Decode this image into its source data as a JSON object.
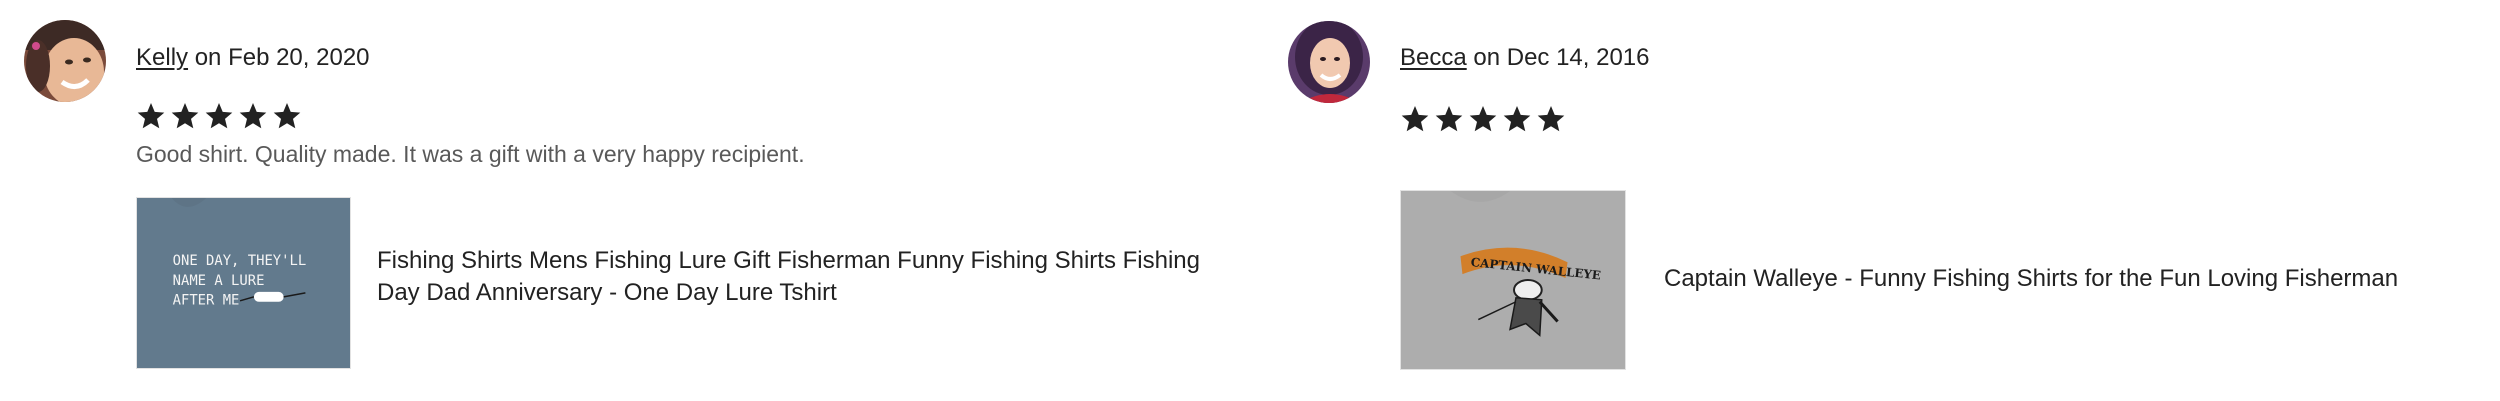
{
  "reviews": [
    {
      "reviewer": "Kelly",
      "date_prefix": " on ",
      "date": "Feb 20, 2020",
      "rating": 5,
      "text": "Good shirt. Quality made. It was a gift with a very happy recipient.",
      "product": {
        "title": "Fishing Shirts Mens Fishing Lure Gift Fisherman Funny Fishing Shirts Fishing Day Dad Anniversary - One Day Lure Tshirt",
        "shirt_color": "#5e7486",
        "shirt_print": [
          "ONE DAY, THEY'LL",
          "NAME A LURE",
          "AFTER ME"
        ]
      }
    },
    {
      "reviewer": "Becca",
      "date_prefix": " on ",
      "date": "Dec 14, 2016",
      "rating": 5,
      "text": "",
      "product": {
        "title": "Captain Walleye - Funny Fishing Shirts for the Fun Loving Fisherman",
        "shirt_color": "#a7a7a7",
        "shirt_print": [
          "CAPTAIN WALLEYE"
        ]
      }
    }
  ],
  "colors": {
    "text_primary": "#222222",
    "text_secondary": "#595959",
    "star": "#222222"
  },
  "icons": {
    "star": "star-icon"
  }
}
